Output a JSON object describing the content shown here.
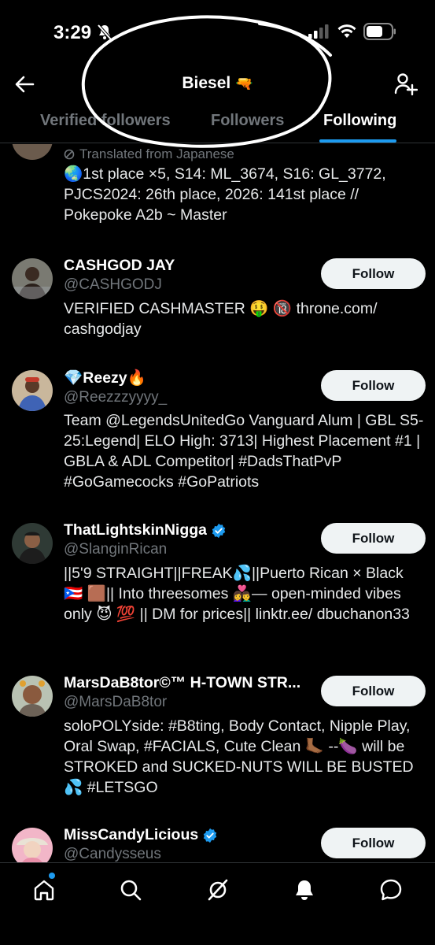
{
  "status": {
    "time": "3:29"
  },
  "header": {
    "title": "Biesel",
    "title_emoji": "🔫"
  },
  "tabs": [
    {
      "label": "Verified followers"
    },
    {
      "label": "Followers"
    },
    {
      "label": "Following"
    }
  ],
  "partial_entry": {
    "translated": "Translated from Japanese",
    "bio": "🌏1st place ×5, S14: ML_3674, S16: GL_3772, PJCS2024: 26th place, 2026: 141st place // Pokepoke A2b ~ Master"
  },
  "follow_label": "Follow",
  "users": [
    {
      "name": "CASHGOD JAY",
      "handle": "@CASHGODJ",
      "verified": false,
      "bio": "VERIFIED CASHMASTER 🤑 🔞 throne.com/ cashgodjay"
    },
    {
      "name": "💎Reezy🔥",
      "handle": "@Reezzzyyyy_",
      "verified": false,
      "bio": "Team @LegendsUnitedGo Vanguard Alum | GBL S5-25:Legend| ELO High: 3713| Highest Placement #1 | GBLA & ADL Competitor| #DadsThatPvP #GoGamecocks #GoPatriots"
    },
    {
      "name": "ThatLightskinNigga",
      "handle": "@SlanginRican",
      "verified": true,
      "bio": "||5'9 STRAIGHT||FREAK💦||Puerto Rican × Black 🇵🇷 🟫|| Into threesomes 👩‍❤️‍👨— open-minded vibes only 😈 💯 || DM for prices|| linktr.ee/ dbuchanon33"
    },
    {
      "name": "MarsDaB8tor©™ H-TOWN STR...",
      "handle": "@MarsDaB8tor",
      "verified": false,
      "bio": "soloPOLYside: #B8ting, Body Contact, Nipple Play, Oral Swap, #FACIALS, Cute Clean 🦶🏾 --🍆 will be STROKED and SUCKED-NUTS WILL BE BUSTED 💦 #LETSGO"
    },
    {
      "name": "MissCandyLicious",
      "handle": "@Candysseus",
      "verified": true,
      "bio": ""
    }
  ],
  "nav": [
    "home-icon",
    "search-icon",
    "grok-icon",
    "notifications-icon",
    "messages-icon"
  ],
  "colors": {
    "accent": "#1d9bf0",
    "background": "#000000",
    "muted": "#71767b",
    "button": "#eff3f4"
  }
}
